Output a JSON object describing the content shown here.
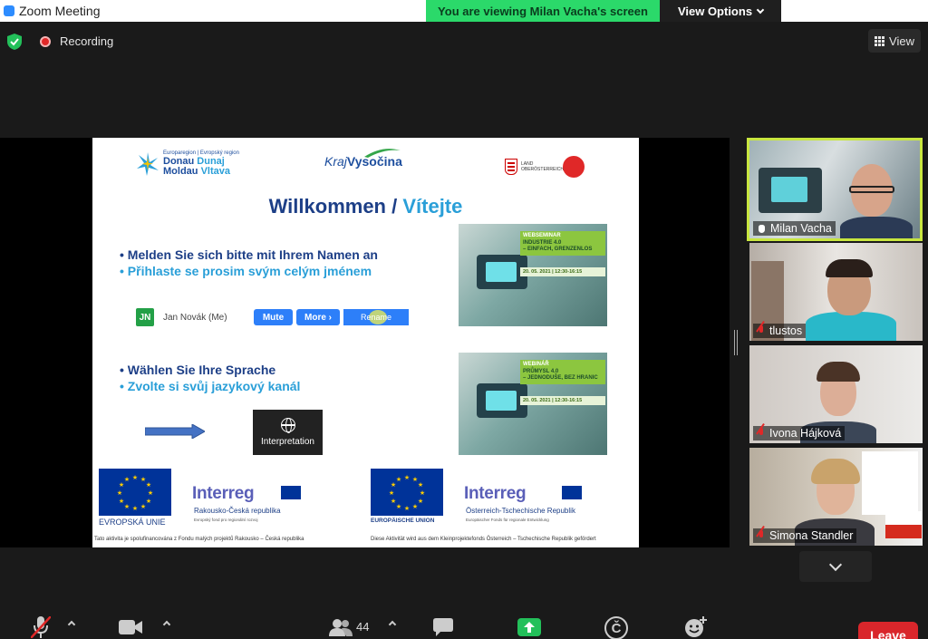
{
  "window": {
    "title": "Zoom Meeting"
  },
  "banner": {
    "message": "You are viewing Milan Vacha's screen",
    "options_label": "View Options"
  },
  "topbar": {
    "recording_label": "Recording",
    "view_label": "View"
  },
  "slide": {
    "logo_donau_small": "Europaregion | Evropský region",
    "logo_donau_line1a": "Donau",
    "logo_donau_line1b": "Dunaj",
    "logo_donau_line2a": "Moldau",
    "logo_donau_line2b": "Vltava",
    "logo_vysocina_a": "Kraj",
    "logo_vysocina_b": "Vysočina",
    "logo_ooe": "LAND OBERÖSTERREICH",
    "title_de": "Willkommen /",
    "title_cs": "Vítejte",
    "bullet1_de": "•  Melden Sie sich bitte mit Ihrem Namen an",
    "bullet1_cs": "•  Přihlaste se prosim svým celým jménem",
    "demo_initials": "JN",
    "demo_name": "Jan Novák (Me)",
    "demo_mute": "Mute",
    "demo_more": "More ›",
    "demo_rename": "Rename",
    "bullet2_de": "•  Wählen Sie Ihre Sprache",
    "bullet2_cs": "•  Zvolte si svůj jazykový kanál",
    "interpretation_label": "Interpretation",
    "web1_kind": "WEBSEMINAR",
    "web1_title1": "INDUSTRIE 4.0",
    "web1_title2": "– EINFACH, GRENZENLOS",
    "web1_date": "20. 05. 2021 | 12:30-16:15",
    "web2_kind": "WEBINÁŘ",
    "web2_title1": "PRŮMYSL 4.0",
    "web2_title2": "– JEDNODUŠE, BEZ HRANIC",
    "web2_date": "20. 05. 2021 | 12:30-16:15",
    "eu_left_label": "EVROPSKÁ UNIE",
    "eu_right_label": "EUROPÄISCHE UNION",
    "interreg_word": "Interreg",
    "interreg_left_sub": "Rakousko-Česká republika",
    "interreg_left_sub2": "Evropský fond pro regionální rozvoj",
    "interreg_right_sub": "Österreich-Tschechische Republik",
    "interreg_right_sub2": "Europäischer Fonds für regionale Entwicklung",
    "mini_eu_label": "EVROPSKÁ UNIE",
    "footnote_left": "Tato aktivita je spolufinancována z Fondu malých projektů Rakousko – Česká republika",
    "footnote_right": "Diese Aktivität wird aus dem Kleinprojektefonds Österreich – Tschechische Republik gefördert"
  },
  "participants": [
    {
      "name": "Milan Vacha",
      "active": true,
      "status_icon": "raised-hand-icon"
    },
    {
      "name": "tlustos",
      "active": false,
      "status_icon": "mic-muted-icon"
    },
    {
      "name": "Ivona Hájková",
      "active": false,
      "status_icon": "mic-muted-icon"
    },
    {
      "name": "Simona Standler",
      "active": false,
      "status_icon": "mic-muted-icon"
    }
  ],
  "toolbar": {
    "participants_count": "44",
    "leave_label": "Leave",
    "caption_letter": "Č",
    "icons": [
      "mic-muted-icon",
      "video-icon",
      "participants-icon",
      "chat-icon",
      "share-screen-icon",
      "captions-icon",
      "reactions-icon"
    ]
  },
  "colors": {
    "banner_green": "#2bd96a",
    "share_green": "#23c05a",
    "leave_red": "#d9262b",
    "active_border": "#c8e63f"
  }
}
